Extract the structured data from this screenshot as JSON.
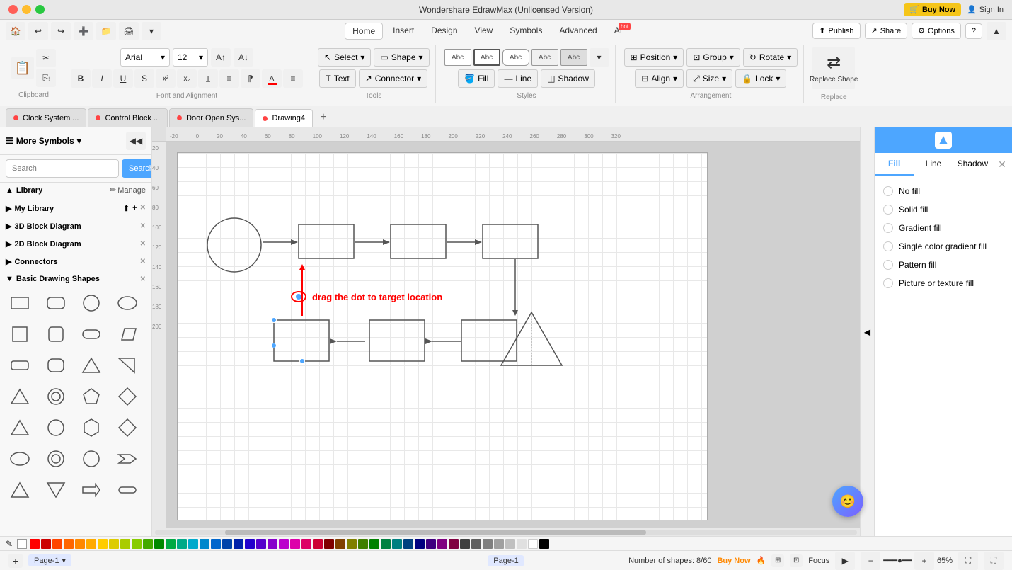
{
  "app": {
    "title": "Wondershare EdrawMax (Unlicensed Version)",
    "buy_btn": "Buy Now",
    "sign_in": "Sign In"
  },
  "menu": {
    "items": [
      "Home",
      "Insert",
      "Design",
      "View",
      "Symbols",
      "Advanced",
      "AI"
    ],
    "active": "Home",
    "ai_badge": "hot"
  },
  "toolbar": {
    "font_family": "Arial",
    "font_size": "12",
    "select_label": "Select",
    "shape_label": "Shape",
    "text_label": "Text",
    "connector_label": "Connector",
    "clipboard_label": "Clipboard",
    "font_alignment_label": "Font and Alignment",
    "tools_label": "Tools",
    "styles_label": "Styles",
    "fill_label": "Fill",
    "line_label": "Line",
    "shadow_label": "Shadow",
    "position_label": "Position",
    "group_label": "Group",
    "rotate_label": "Rotate",
    "align_label": "Align",
    "size_label": "Size",
    "lock_label": "Lock",
    "arrangement_label": "Arrangement",
    "replace_shape_label": "Replace Shape",
    "replace_label": "Replace",
    "publish_label": "Publish",
    "share_label": "Share",
    "options_label": "Options",
    "help_label": "?"
  },
  "tabs": [
    {
      "id": "clock-system",
      "label": "Clock System ...",
      "dot_color": "#ff4444",
      "active": false
    },
    {
      "id": "control-block",
      "label": "Control Block ...",
      "dot_color": "#ff4444",
      "active": false
    },
    {
      "id": "door-open-sys",
      "label": "Door Open Sys...",
      "dot_color": "#ff4444",
      "active": false
    },
    {
      "id": "drawing4",
      "label": "Drawing4",
      "dot_color": "#ff4444",
      "active": true
    }
  ],
  "left_panel": {
    "title": "More Symbols",
    "search_placeholder": "Search",
    "search_btn": "Search",
    "library_label": "Library",
    "manage_label": "Manage",
    "my_library_label": "My Library",
    "groups": [
      {
        "id": "3d-block",
        "label": "3D Block Diagram",
        "expanded": false
      },
      {
        "id": "2d-block",
        "label": "2D Block Diagram",
        "expanded": false
      },
      {
        "id": "connectors",
        "label": "Connectors",
        "expanded": false
      },
      {
        "id": "basic-shapes",
        "label": "Basic Drawing Shapes",
        "expanded": true
      }
    ]
  },
  "canvas": {
    "drag_tooltip": "drag the dot to target location",
    "zoom": "65%",
    "page_name": "Page-1",
    "status": "Number of shapes: 8/60",
    "buy_now": "Buy Now",
    "focus_label": "Focus"
  },
  "right_panel": {
    "tabs": [
      "Fill",
      "Line",
      "Shadow"
    ],
    "active_tab": "Fill",
    "fill_options": [
      {
        "id": "no-fill",
        "label": "No fill",
        "active": false
      },
      {
        "id": "solid-fill",
        "label": "Solid fill",
        "active": false
      },
      {
        "id": "gradient-fill",
        "label": "Gradient fill",
        "active": false
      },
      {
        "id": "single-color-gradient",
        "label": "Single color gradient fill",
        "active": false
      },
      {
        "id": "pattern-fill",
        "label": "Pattern fill",
        "active": false
      },
      {
        "id": "picture-texture",
        "label": "Picture or texture fill",
        "active": false
      }
    ]
  },
  "color_palette": [
    "#ff0000",
    "#ff2200",
    "#ff4400",
    "#ff6600",
    "#ff8800",
    "#ffaa00",
    "#ffcc00",
    "#ffee00",
    "#ccff00",
    "#aaff00",
    "#88ff00",
    "#66ff00",
    "#44ff00",
    "#22ff00",
    "#00ff00",
    "#00ff22",
    "#00ff44",
    "#00ff66",
    "#00ff88",
    "#00ffaa",
    "#00ffcc",
    "#00ffee",
    "#00eeff",
    "#00ccff",
    "#00aaff",
    "#0088ff",
    "#0066ff",
    "#0044ff",
    "#0022ff",
    "#0000ff",
    "#2200ff",
    "#4400ff",
    "#6600ff",
    "#8800ff",
    "#aa00ff",
    "#cc00ff",
    "#ee00ff",
    "#ff00ee",
    "#ff00cc",
    "#ff00aa",
    "#ff0088",
    "#ff0066",
    "#ff0044",
    "#ff0022",
    "#800000",
    "#804000",
    "#808000",
    "#408000",
    "#008000",
    "#008040",
    "#008080",
    "#004080",
    "#000080",
    "#400080",
    "#800080",
    "#800040",
    "#404040",
    "#606060",
    "#808080",
    "#a0a0a0",
    "#c0c0c0",
    "#e0e0e0",
    "#ffffff",
    "#000000"
  ]
}
